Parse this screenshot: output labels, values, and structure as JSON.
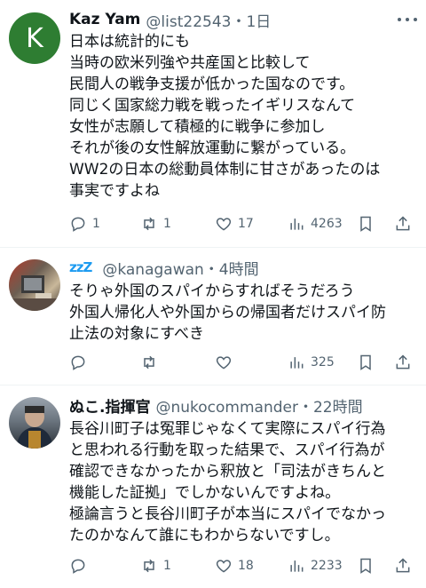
{
  "tweets": [
    {
      "avatar_letter": "K",
      "name": "Kaz Yam",
      "handle_time": "@list22543・1日",
      "lines": [
        "日本は統計的にも",
        "当時の欧米列強や共産国と比較して",
        "民間人の戦争支援が低かった国なのです。",
        "同じく国家総力戦を戦ったイギリスなんて",
        "女性が志願して積極的に戦争に参加し",
        "それが後の女性解放運動に繋がっている。",
        "WW2の日本の総動員体制に甘さがあったのは",
        "事実ですよね"
      ],
      "replies": "1",
      "reposts": "1",
      "likes": "17",
      "views": "4263"
    },
    {
      "name_prefix": "zzZ",
      "name": "",
      "handle_time": "@kanagawan・4時間",
      "lines": [
        "そりゃ外国のスパイからすればそうだろう",
        "外国人帰化人や外国からの帰国者だけスパイ防",
        "止法の対象にすべき"
      ],
      "replies": "",
      "reposts": "",
      "likes": "",
      "views": "325"
    },
    {
      "name": "ぬこ.指揮官",
      "handle_time": "@nukocommander・22時間",
      "lines": [
        "長谷川町子は冤罪じゃなくて実際にスパイ行為",
        "と思われる行動を取った結果で、スパイ行為が",
        "確認できなかったから釈放と「司法がきちんと",
        "機能した証拠」でしかないんですよね。",
        "極論言うと長谷川町子が本当にスパイでなかっ",
        "たのかなんて誰にもわからないですし。"
      ],
      "replies": "",
      "reposts": "1",
      "likes": "18",
      "views": "2233"
    }
  ],
  "colors": {
    "text": "#0f1419",
    "meta": "#536471",
    "divider": "#eff3f4",
    "avatar_k": "#2e7d32",
    "zzz": "#1d9bf0"
  }
}
